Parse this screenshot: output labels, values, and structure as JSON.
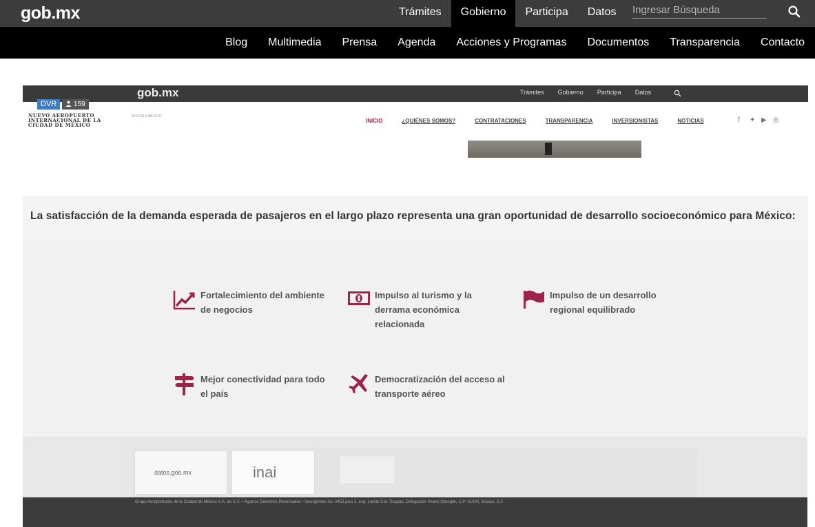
{
  "header": {
    "brand": "gob.mx",
    "nav": [
      "Trámites",
      "Gobierno",
      "Participa",
      "Datos"
    ],
    "active_nav": "Gobierno",
    "search_placeholder": "Ingresar Búsqueda"
  },
  "subnav": [
    "Blog",
    "Multimedia",
    "Prensa",
    "Agenda",
    "Acciones y Programas",
    "Documentos",
    "Transparencia",
    "Contacto"
  ],
  "video": {
    "brand": "gob.mx",
    "nav": [
      "Trámites",
      "Gobierno",
      "Participa",
      "Datos"
    ],
    "dvr_label": "DVR",
    "viewer_count": "159",
    "site_logo": "NUEVO AEROPUERTO INTERNACIONAL DE LA CIUDAD DE MÉXICO",
    "site_logo2": "MOVER A MÉXICO",
    "menu": [
      "INICIO",
      "¿QUIÉNES SOMOS?",
      "CONTRATACIONES",
      "TRANSPARENCIA",
      "INVERSIONISTAS",
      "NOTICIAS"
    ],
    "statement": "La satisfacción de la demanda esperada de pasajeros en el largo plazo representa una gran oportunidad de desarrollo socioeconómico para México:",
    "benefits": [
      {
        "icon": "trend-up-icon",
        "text": "Fortalecimiento del ambiente de negocios"
      },
      {
        "icon": "money-bill-icon",
        "text": "Impulso al turismo y la derrama económica relacionada"
      },
      {
        "icon": "flag-icon",
        "text": "Impulso de un desarrollo regional equilibrado"
      },
      {
        "icon": "signpost-icon",
        "text": "Mejor conectividad para todo el país"
      },
      {
        "icon": "airplane-icon",
        "text": "Democratización del acceso al transporte aéreo"
      }
    ],
    "partners": [
      "datos.gob.mx",
      "inai"
    ],
    "footer": "Grupo Aeroportuario de la Ciudad de México S.A. de C.V. • Algunos Derechos Reservados • Insurgentes Sur 2453 piso 2, esq. Loreto Col. Tizapan, Delegación Álvaro Obregón, C.P. 01090, México, D.F."
  },
  "colors": {
    "topbar": "#3c3c3c",
    "subnav": "#000000",
    "accent": "#9d2449"
  }
}
